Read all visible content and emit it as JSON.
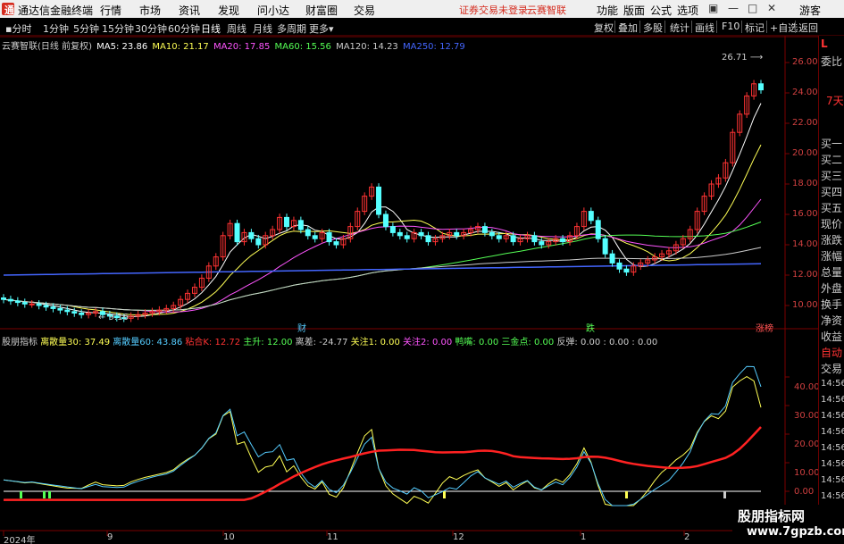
{
  "titlebar": {
    "app_name": "通达信金融终端",
    "menus": [
      "行情",
      "市场",
      "资讯",
      "发现",
      "问小达",
      "财富圈",
      "交易"
    ],
    "alert": "证券交易未登录",
    "stock_name": "云赛智联",
    "right_menus": [
      "功能",
      "版面",
      "公式",
      "选项"
    ],
    "guest": "游客",
    "logo_char": "通"
  },
  "toolbar": {
    "periods": [
      "分时",
      "1分钟",
      "5分钟",
      "15分钟",
      "30分钟",
      "60分钟",
      "日线",
      "周线",
      "月线",
      "多周期",
      "更多"
    ],
    "active_period": "日线",
    "buttons": [
      "复权",
      "叠加",
      "多股",
      "统计",
      "画线",
      "F10",
      "标记",
      "+自选",
      "返回"
    ]
  },
  "chart_title": "云赛智联(日线 前复权)",
  "ma_legend": [
    {
      "label": "MA5: 23.86",
      "color": "#ffffff"
    },
    {
      "label": "MA10: 21.17",
      "color": "#ffff55"
    },
    {
      "label": "MA20: 17.85",
      "color": "#ff55ff"
    },
    {
      "label": "MA60: 15.56",
      "color": "#55ff55"
    },
    {
      "label": "MA120: 14.23",
      "color": "#cccccc"
    },
    {
      "label": "MA250: 12.79",
      "color": "#4466ff"
    }
  ],
  "indicator_legend": [
    {
      "label": "股朋指标",
      "color": "#cccccc"
    },
    {
      "label": "离散量30: 37.49",
      "color": "#ffff55"
    },
    {
      "label": "离散量60: 43.86",
      "color": "#55ccff"
    },
    {
      "label": "粘合K: 12.72",
      "color": "#ff3333"
    },
    {
      "label": "主升: 12.00",
      "color": "#55ff55"
    },
    {
      "label": "离差: -24.77",
      "color": "#cccccc"
    },
    {
      "label": "关注1: 0.00",
      "color": "#ffff55"
    },
    {
      "label": "关注2: 0.00",
      "color": "#ff55ff"
    },
    {
      "label": "鸭嘴: 0.00",
      "color": "#55ff55"
    },
    {
      "label": "三金点: 0.00",
      "color": "#55ff55"
    },
    {
      "label": "反弹: 0.00 : 0.00 : 0.00",
      "color": "#cccccc"
    }
  ],
  "price_axis": [
    "26.00",
    "24.00",
    "22.00",
    "20.00",
    "18.00",
    "16.00",
    "14.00",
    "12.00",
    "10.00"
  ],
  "indicator_axis": [
    "40.00",
    "30.00",
    "20.00",
    "10.00",
    "0.00"
  ],
  "annotations": {
    "high": "26.71",
    "low": "9.16",
    "event1": "财",
    "event2": "跌",
    "event3": "涨榜"
  },
  "dates": [
    "2024年",
    "9",
    "10",
    "11",
    "12",
    "1",
    "2"
  ],
  "right_panel": {
    "top": "L",
    "items": [
      "委比",
      "7天",
      "买一",
      "买二",
      "买三",
      "买四",
      "买五",
      "现价",
      "涨跌",
      "涨幅",
      "总量",
      "外盘",
      "换手",
      "净资",
      "收益",
      "自动",
      "交易"
    ],
    "times": [
      "14:56",
      "14:56",
      "14:56",
      "14:56",
      "14:56",
      "14:56",
      "14:56",
      "14:56"
    ]
  },
  "watermark": {
    "line1": "股朋指标网",
    "line2": "www.7gpzb.com"
  },
  "chart_data": {
    "type": "candlestick",
    "title": "云赛智联(日线 前复权)",
    "ylim": [
      9,
      27
    ],
    "closes": [
      10.4,
      10.3,
      10.2,
      10.1,
      10.1,
      10.0,
      9.9,
      9.8,
      9.7,
      9.6,
      9.5,
      9.4,
      9.5,
      9.6,
      9.4,
      9.3,
      9.2,
      9.16,
      9.3,
      9.4,
      9.5,
      9.6,
      9.7,
      9.8,
      10.0,
      10.4,
      10.8,
      11.2,
      11.8,
      12.6,
      13.2,
      14.6,
      15.4,
      14.2,
      14.8,
      14.4,
      14.0,
      14.6,
      15.0,
      15.8,
      15.2,
      15.6,
      15.0,
      14.6,
      14.4,
      14.8,
      14.2,
      14.0,
      14.4,
      15.2,
      16.2,
      17.2,
      17.8,
      16.0,
      15.2,
      14.8,
      14.6,
      14.4,
      14.8,
      14.6,
      14.2,
      14.4,
      14.6,
      14.8,
      14.6,
      14.8,
      15.0,
      15.2,
      14.8,
      14.6,
      14.4,
      14.6,
      14.2,
      14.4,
      14.6,
      14.2,
      14.0,
      14.2,
      14.4,
      14.2,
      14.6,
      15.2,
      16.2,
      15.6,
      14.4,
      13.4,
      12.8,
      12.4,
      12.2,
      12.6,
      12.8,
      13.0,
      13.2,
      13.4,
      13.6,
      14.0,
      14.4,
      15.0,
      16.2,
      17.2,
      18.0,
      18.4,
      19.4,
      21.4,
      22.6,
      23.8,
      24.6,
      24.2
    ]
  }
}
